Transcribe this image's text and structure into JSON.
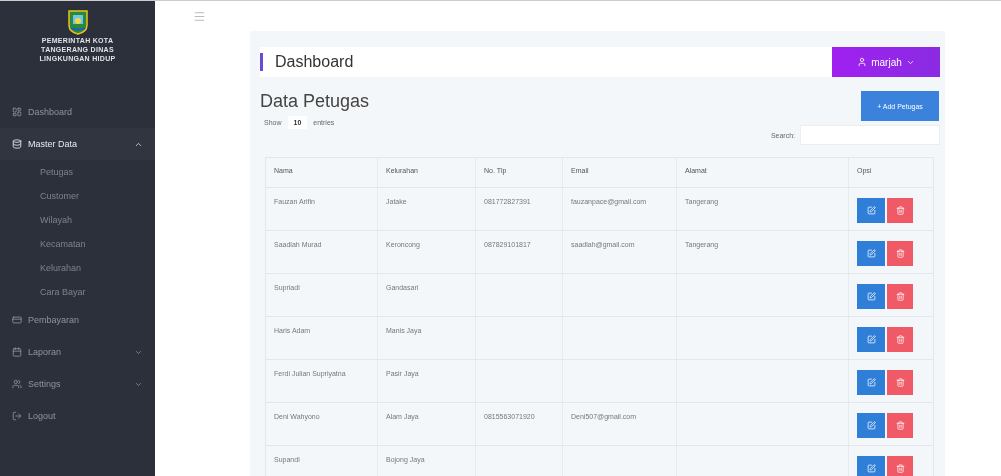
{
  "sidebar": {
    "logo_text": [
      "PEMERINTAH KOTA",
      "TANGERANG DINAS",
      "LINGKUNGAN HIDUP"
    ],
    "items": [
      {
        "label": "Dashboard",
        "kind": "link",
        "selected": false
      },
      {
        "label": "Master Data",
        "kind": "group",
        "selected": true,
        "expanded": true,
        "children": [
          {
            "label": "Petugas"
          },
          {
            "label": "Customer"
          },
          {
            "label": "Wilayah"
          },
          {
            "label": "Kecamatan"
          },
          {
            "label": "Kelurahan"
          },
          {
            "label": "Cara Bayar"
          }
        ]
      },
      {
        "label": "Pembayaran",
        "kind": "link",
        "selected": false
      },
      {
        "label": "Laporan",
        "kind": "group",
        "selected": false,
        "expanded": false
      },
      {
        "label": "Settings",
        "kind": "group",
        "selected": false,
        "expanded": false
      },
      {
        "label": "Logout",
        "kind": "link",
        "selected": false
      }
    ]
  },
  "header": {
    "title": "Dashboard",
    "user": "marjah"
  },
  "page": {
    "title": "Data Petugas",
    "add_button": "+ Add Petugas",
    "show_label": "Show",
    "entries_value": "10",
    "entries_label": "entries",
    "search_label": "Search:"
  },
  "table": {
    "columns": [
      "Nama",
      "Kelurahan",
      "No. Tlp",
      "Email",
      "Alamat",
      "Opsi"
    ],
    "rows": [
      [
        "Fauzan Arifin",
        "Jatake",
        "081772827391",
        "fauzanpace@gmail.com",
        "Tangerang"
      ],
      [
        "Saadlah Murad",
        "Keroncong",
        "087829101817",
        "saadlah@gmail.com",
        "Tangerang"
      ],
      [
        "Supriadi",
        "Gandasari",
        "",
        "",
        ""
      ],
      [
        "Haris Adam",
        "Manis Jaya",
        "",
        "",
        ""
      ],
      [
        "Ferdi Julian Supriyatna",
        "Pasir Jaya",
        "",
        "",
        ""
      ],
      [
        "Deni Wahyono",
        "Alam Jaya",
        "0815563071920",
        "Deni507@gmail.com",
        ""
      ],
      [
        "Supandi",
        "Bojong Jaya",
        "",
        "",
        ""
      ]
    ]
  }
}
